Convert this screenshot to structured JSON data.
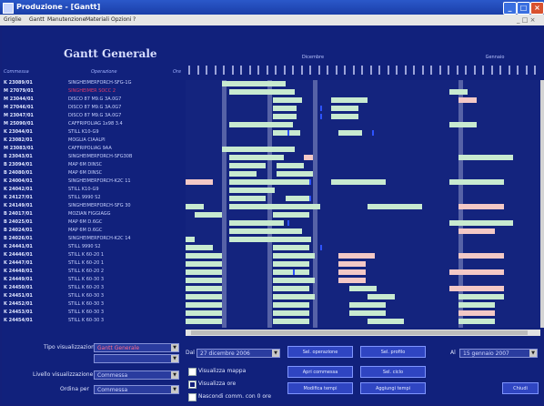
{
  "window": {
    "title": "Produzione - [Gantt]",
    "icon": "app-icon"
  },
  "menu": {
    "items": [
      "Griglie",
      "Gantt",
      "Manutenzione",
      "Materiali",
      "Opzioni",
      "?"
    ],
    "mdi_controls": "_ □ ×"
  },
  "heading": "Gantt Generale",
  "columns": {
    "commessa": "Commessa",
    "operazione": "Operazione",
    "ore": "Ore"
  },
  "months": [
    "Dicembre",
    "Gennaio"
  ],
  "rows": [
    {
      "code": "K 23089/01",
      "op": "SINGHEIMERFORCH-SFG-1G",
      "hl": false
    },
    {
      "code": "M 27079/01",
      "op": "SINGHEIMER SOCC 2",
      "hl": true
    },
    {
      "code": "M 23044/01",
      "op": "DISCO 87 M9.G 3A.0G7",
      "hl": false
    },
    {
      "code": "M 27046/01",
      "op": "DISCO 87 M9.G 3A.0G7",
      "hl": false
    },
    {
      "code": "M 23047/01",
      "op": "DISCO 87 M9.G 3A.0G7",
      "hl": false
    },
    {
      "code": "M 25090/01",
      "op": "CAFFRIPOLIAG 1x98 3.4",
      "hl": false
    },
    {
      "code": "K 23044/01",
      "op": "STILL K10-G9",
      "hl": false
    },
    {
      "code": "K 23082/01",
      "op": "MOGLIA CIAALPI",
      "hl": false
    },
    {
      "code": "M 23083/01",
      "op": "CAFFRIPOLIAG 9AA",
      "hl": false
    },
    {
      "code": "B 23043/01",
      "op": "SINGHEIMERFORCH-SFG30B",
      "hl": false
    },
    {
      "code": "B 23094/01",
      "op": "MAP 6M DINSC",
      "hl": false
    },
    {
      "code": "B 24080/01",
      "op": "MAP 6M DINSC",
      "hl": false
    },
    {
      "code": "K 24004/01",
      "op": "SINGHEIMERFORCH-K2C 11",
      "hl": false
    },
    {
      "code": "K 24042/01",
      "op": "STILL K10-G9",
      "hl": false
    },
    {
      "code": "K 24127/01",
      "op": "STILL 9990 S2",
      "hl": false
    },
    {
      "code": "K 24149/01",
      "op": "SINGHEIMERFORCH-SFG 30",
      "hl": false
    },
    {
      "code": "B 24017/01",
      "op": "MOZIAN FIGGIAGG",
      "hl": false
    },
    {
      "code": "B 24025/01",
      "op": "MAP 6M D.6GC",
      "hl": false
    },
    {
      "code": "B 24024/01",
      "op": "MAP 6M D.6GC",
      "hl": false
    },
    {
      "code": "B 24026/01",
      "op": "SINGHEIMERFORCH-K2C 14",
      "hl": false
    },
    {
      "code": "K 24441/01",
      "op": "STILL 9990 S2",
      "hl": false
    },
    {
      "code": "K 24446/01",
      "op": "STILL K 60-20 1",
      "hl": false
    },
    {
      "code": "K 24447/01",
      "op": "STILL K 60-20 1",
      "hl": false
    },
    {
      "code": "K 24448/01",
      "op": "STILL K 60-20 2",
      "hl": false
    },
    {
      "code": "K 24449/01",
      "op": "STILL K 60-30 3",
      "hl": false
    },
    {
      "code": "K 24450/01",
      "op": "STILL K 60-20 3",
      "hl": false
    },
    {
      "code": "K 24451/01",
      "op": "STILL K 60-30 3",
      "hl": false
    },
    {
      "code": "K 24452/01",
      "op": "STILL K 60-30 3",
      "hl": false
    },
    {
      "code": "K 24453/01",
      "op": "STILL K 60-30 3",
      "hl": false
    },
    {
      "code": "K 24454/01",
      "op": "STILL K 60-30 3",
      "hl": false
    }
  ],
  "controls": {
    "tipo_label": "Tipo visualizzazione",
    "tipo_value": "Gantt Generale",
    "livello_label": "Livello visualizzazione",
    "livello_value": "Commessa",
    "ordina_label": "Ordina per",
    "ordina_value": "Commessa",
    "dal_label": "Dal",
    "dal_value": "27 dicembre 2006",
    "al_label": "Al",
    "al_value": "15 gennaio 2007",
    "chk_mappa": "Visualizza mappa",
    "chk_ore": "Visualizza ore",
    "chk_nascondi": "Nascondi comm. con 0 ore",
    "chk_mappa_on": false,
    "chk_ore_on": true,
    "chk_nascondi_on": false,
    "btn1": "Sel. operazione",
    "btn2": "Sel. profilo",
    "btn3": "Apri commessa",
    "btn4": "Sel. ciclo",
    "btn5": "Modifica tempi",
    "btn6": "Aggiungi tempi",
    "btn7": "Chiudi"
  },
  "colors": {
    "bar_green": "#c8ead0",
    "bar_pink": "#f3c8c6",
    "mark_blue": "#2d53ff",
    "background": "#13207a"
  }
}
